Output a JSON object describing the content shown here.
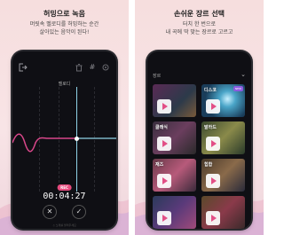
{
  "left_panel": {
    "title": "허밍으로 녹음",
    "subtitle_line1": "머릿속 멜로디를 허밍하는 순간",
    "subtitle_line2": "살아있는 음악이 된다!",
    "screen": {
      "track_label": "멜로디",
      "rec_badge": "REC",
      "elapsed_time": "00:04:27",
      "cancel_glyph": "✕",
      "confirm_glyph": "✓",
      "footer_hint": "♫ 노래를 불러주세요"
    },
    "colors": {
      "waveform": "#d9478a",
      "playhead": "#8fd3e8"
    }
  },
  "right_panel": {
    "title": "손쉬운 장르 선택",
    "subtitle_line1": "터치 한 번으로",
    "subtitle_line2": "내 곡에 딱 맞는 장르로 고르고",
    "screen": {
      "header_label": "장르",
      "genres": [
        {
          "name": "",
          "badge": ""
        },
        {
          "name": "디스코",
          "badge": "NEW"
        },
        {
          "name": "클래식",
          "badge": ""
        },
        {
          "name": "발라드",
          "badge": ""
        },
        {
          "name": "재즈",
          "badge": ""
        },
        {
          "name": "힙합",
          "badge": ""
        },
        {
          "name": "",
          "badge": ""
        },
        {
          "name": "",
          "badge": ""
        }
      ]
    }
  },
  "icons": [
    "exit-icon",
    "trash-icon",
    "hash-icon",
    "settings-icon",
    "play-icon",
    "chevron-down-icon"
  ]
}
